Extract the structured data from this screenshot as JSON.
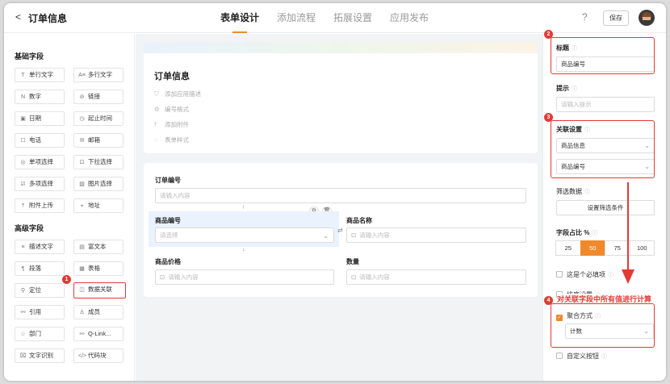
{
  "header": {
    "back": "<",
    "title": "订单信息",
    "tabs": [
      {
        "label": "表单设计"
      },
      {
        "label": "添加流程"
      },
      {
        "label": "拓展设置"
      },
      {
        "label": "应用发布"
      }
    ],
    "help": "?",
    "save_label": "保存"
  },
  "palette": {
    "basic_title": "基础字段",
    "advanced_title": "高级字段",
    "basic": [
      {
        "icon": "T",
        "label": "单行文字"
      },
      {
        "icon": "A≡",
        "label": "多行文字"
      },
      {
        "icon": "N",
        "label": "数字"
      },
      {
        "icon": "⊘",
        "label": "链接"
      },
      {
        "icon": "▣",
        "label": "日期"
      },
      {
        "icon": "◷",
        "label": "起止时间"
      },
      {
        "icon": "☐",
        "label": "电话"
      },
      {
        "icon": "✉",
        "label": "邮箱"
      },
      {
        "icon": "◎",
        "label": "单项选择"
      },
      {
        "icon": "⊡",
        "label": "下拉选择"
      },
      {
        "icon": "☑",
        "label": "多项选择"
      },
      {
        "icon": "▨",
        "label": "图片选择"
      },
      {
        "icon": "⤒",
        "label": "附件上传"
      },
      {
        "icon": "⌖",
        "label": "地址"
      }
    ],
    "advanced": [
      {
        "icon": "≡",
        "label": "描述文字"
      },
      {
        "icon": "▤",
        "label": "富文本"
      },
      {
        "icon": "¶",
        "label": "段落"
      },
      {
        "icon": "▦",
        "label": "表格"
      },
      {
        "icon": "⚲",
        "label": "定位"
      },
      {
        "icon": "◫",
        "label": "数据关联"
      },
      {
        "icon": "⚯",
        "label": "引用"
      },
      {
        "icon": "♙",
        "label": "成员"
      },
      {
        "icon": "♧",
        "label": "部门"
      },
      {
        "icon": "⚯",
        "label": "Q-Link..."
      },
      {
        "icon": "⌧",
        "label": "文字识别"
      },
      {
        "icon": "</>",
        "label": "代码块"
      }
    ]
  },
  "form": {
    "title": "订单信息",
    "meta": [
      {
        "icon": "⛉",
        "label": "添加应用描述"
      },
      {
        "icon": "⚙",
        "label": "编号格式"
      },
      {
        "icon": "⤒",
        "label": "添加附件"
      },
      {
        "icon": "◌",
        "label": "表单样式"
      }
    ],
    "fields": {
      "order_no": {
        "label": "订单编号",
        "placeholder": "请输入内容"
      },
      "product_no": {
        "label": "商品编号",
        "placeholder": "请选择"
      },
      "product_name": {
        "label": "商品名称",
        "placeholder": "请输入内容"
      },
      "price": {
        "label": "商品价格",
        "placeholder": "请输入内容"
      },
      "quantity": {
        "label": "数量",
        "placeholder": "请输入内容"
      }
    }
  },
  "props": {
    "title_label": "标题",
    "title_value": "商品编号",
    "hint_label": "提示",
    "hint_placeholder": "请输入提示",
    "link_label": "关联设置",
    "link_form": "商品信息",
    "link_field": "商品编号",
    "filter_label": "筛选数据",
    "filter_button": "设置筛选条件",
    "width_label": "字段占比 %",
    "width_options": [
      "25",
      "50",
      "75",
      "100"
    ],
    "width_selected": "50",
    "required_label": "这是个必填项",
    "sort_label": "排序设置",
    "aggregate_label": "聚合方式",
    "aggregate_value": "计数",
    "custom_btn_label": "自定义按钮"
  },
  "annotations": {
    "badges": [
      "1",
      "2",
      "3",
      "4"
    ],
    "note": "对关联字段中所有值进行计算",
    "color": "#e53935"
  },
  "colors": {
    "accent": "#f0892a",
    "annotation": "#e53935"
  }
}
